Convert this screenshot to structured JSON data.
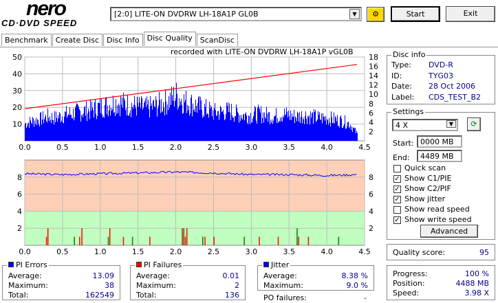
{
  "app": {
    "logo_top": "nero",
    "logo_bottom": "CD·DVD SPEED"
  },
  "toolbar": {
    "drive": "[2:0]  LITE-ON DVDRW LH-18A1P GL0B",
    "start": "Start",
    "exit": "Exit"
  },
  "tabs": [
    "Benchmark",
    "Create Disc",
    "Disc Info",
    "Disc Quality",
    "ScanDisc"
  ],
  "active_tab": "Disc Quality",
  "chart_caption": "recorded with LITE-ON DVDRW LH-18A1P   vGL0B",
  "disc_info": {
    "title": "Disc info",
    "type_label": "Type:",
    "type": "DVD-R",
    "id_label": "ID:",
    "id": "TYG03",
    "date_label": "Date:",
    "date": "28 Oct 2006",
    "label_label": "Label:",
    "label": "CDS_TEST_B2"
  },
  "settings": {
    "title": "Settings",
    "speed": "4 X",
    "start_label": "Start:",
    "start": "0000 MB",
    "end_label": "End:",
    "end": "4489 MB",
    "options": [
      {
        "label": "Quick scan",
        "checked": false
      },
      {
        "label": "Show C1/PIE",
        "checked": true
      },
      {
        "label": "Show C2/PIF",
        "checked": true
      },
      {
        "label": "Show jitter",
        "checked": true
      },
      {
        "label": "Show read speed",
        "checked": false
      },
      {
        "label": "Show write speed",
        "checked": true
      }
    ],
    "advanced": "Advanced"
  },
  "quality": {
    "label": "Quality score:",
    "value": "95"
  },
  "progress": {
    "progress_label": "Progress:",
    "progress": "100 %",
    "position_label": "Position:",
    "position": "4488 MB",
    "speed_label": "Speed:",
    "speed": "3.98 X"
  },
  "pi_errors": {
    "title": "PI Errors",
    "avg_label": "Average:",
    "avg": "13.09",
    "max_label": "Maximum:",
    "max": "38",
    "total_label": "Total:",
    "total": "162549",
    "color": "#0000ff"
  },
  "pi_failures": {
    "title": "PI Failures",
    "avg_label": "Average:",
    "avg": "0.01",
    "max_label": "Maximum:",
    "max": "2",
    "total_label": "Total:",
    "total": "136",
    "color": "#ff0000"
  },
  "jitter": {
    "title": "Jitter",
    "avg_label": "Average:",
    "avg": "8.38 %",
    "max_label": "Maximum:",
    "max": "9.0 %",
    "po_label": "PO failures:",
    "po": "-",
    "color": "#0000ff"
  },
  "chart_data": [
    {
      "type": "bar",
      "series": [
        {
          "name": "PI Errors",
          "x": [
            0,
            0.1,
            0.2,
            0.3,
            0.4,
            0.5,
            0.6,
            0.7,
            0.8,
            0.9,
            1.0,
            1.1,
            1.2,
            1.3,
            1.4,
            1.5,
            1.6,
            1.7,
            1.8,
            1.9,
            2.0,
            2.1,
            2.2,
            2.3,
            2.4,
            2.5,
            2.6,
            2.7,
            2.8,
            2.9,
            3.0,
            3.1,
            3.2,
            3.3,
            3.4,
            3.5,
            3.6,
            3.7,
            3.8,
            3.9,
            4.0,
            4.1,
            4.2,
            4.3,
            4.4
          ],
          "values": [
            12,
            14,
            15,
            17,
            16,
            18,
            19,
            20,
            21,
            22,
            24,
            25,
            27,
            26,
            25,
            24,
            23,
            24,
            26,
            28,
            32,
            28,
            26,
            24,
            22,
            20,
            20,
            21,
            19,
            18,
            18,
            19,
            18,
            17,
            19,
            18,
            17,
            18,
            17,
            16,
            16,
            15,
            14,
            12,
            5
          ]
        },
        {
          "name": "Write speed",
          "x": [
            0,
            4.4
          ],
          "values": [
            6.9,
            16.4
          ],
          "axis": "right"
        }
      ],
      "xlim": [
        0,
        4.5
      ],
      "ylim": [
        0,
        50
      ],
      "y2lim": [
        0,
        18
      ],
      "xticks": [
        "0.0",
        "0.5",
        "1.0",
        "1.5",
        "2.0",
        "2.5",
        "3.0",
        "3.5",
        "4.0",
        "4.5"
      ],
      "yticks": [
        "10",
        "20",
        "30",
        "40",
        "50"
      ],
      "y2ticks": [
        "2",
        "4",
        "6",
        "8",
        "10",
        "12",
        "14",
        "16",
        "18"
      ]
    },
    {
      "type": "bar",
      "series": [
        {
          "name": "Jitter",
          "x": [
            0,
            0.5,
            1.0,
            1.5,
            2.0,
            2.5,
            3.0,
            3.5,
            4.0,
            4.4
          ],
          "values": [
            8.4,
            8.3,
            8.4,
            8.5,
            8.6,
            8.5,
            8.3,
            8.3,
            8.2,
            8.3
          ]
        },
        {
          "name": "PI Failures",
          "x": [
            0.28,
            0.3,
            0.65,
            0.72,
            0.75,
            1.1,
            1.12,
            1.3,
            1.42,
            1.65,
            2.08,
            2.1,
            2.12,
            2.14,
            2.35,
            2.38,
            2.5,
            2.9,
            3.1,
            3.35,
            3.6,
            3.62,
            3.75,
            4.15
          ],
          "values": [
            1,
            2,
            1,
            1,
            2,
            1,
            2,
            1,
            1,
            1,
            2,
            2,
            1,
            2,
            1,
            1,
            1,
            1,
            1,
            1,
            2,
            1,
            1,
            1
          ]
        }
      ],
      "xlim": [
        0,
        4.5
      ],
      "ylim": [
        0,
        10
      ],
      "xticks": [
        "0.0",
        "0.5",
        "1.0",
        "1.5",
        "2.0",
        "2.5",
        "3.0",
        "3.5",
        "4.0",
        "4.5"
      ],
      "yticks": [
        "2",
        "4",
        "6",
        "8"
      ],
      "y2ticks": [
        "2",
        "4",
        "6",
        "8"
      ]
    }
  ]
}
